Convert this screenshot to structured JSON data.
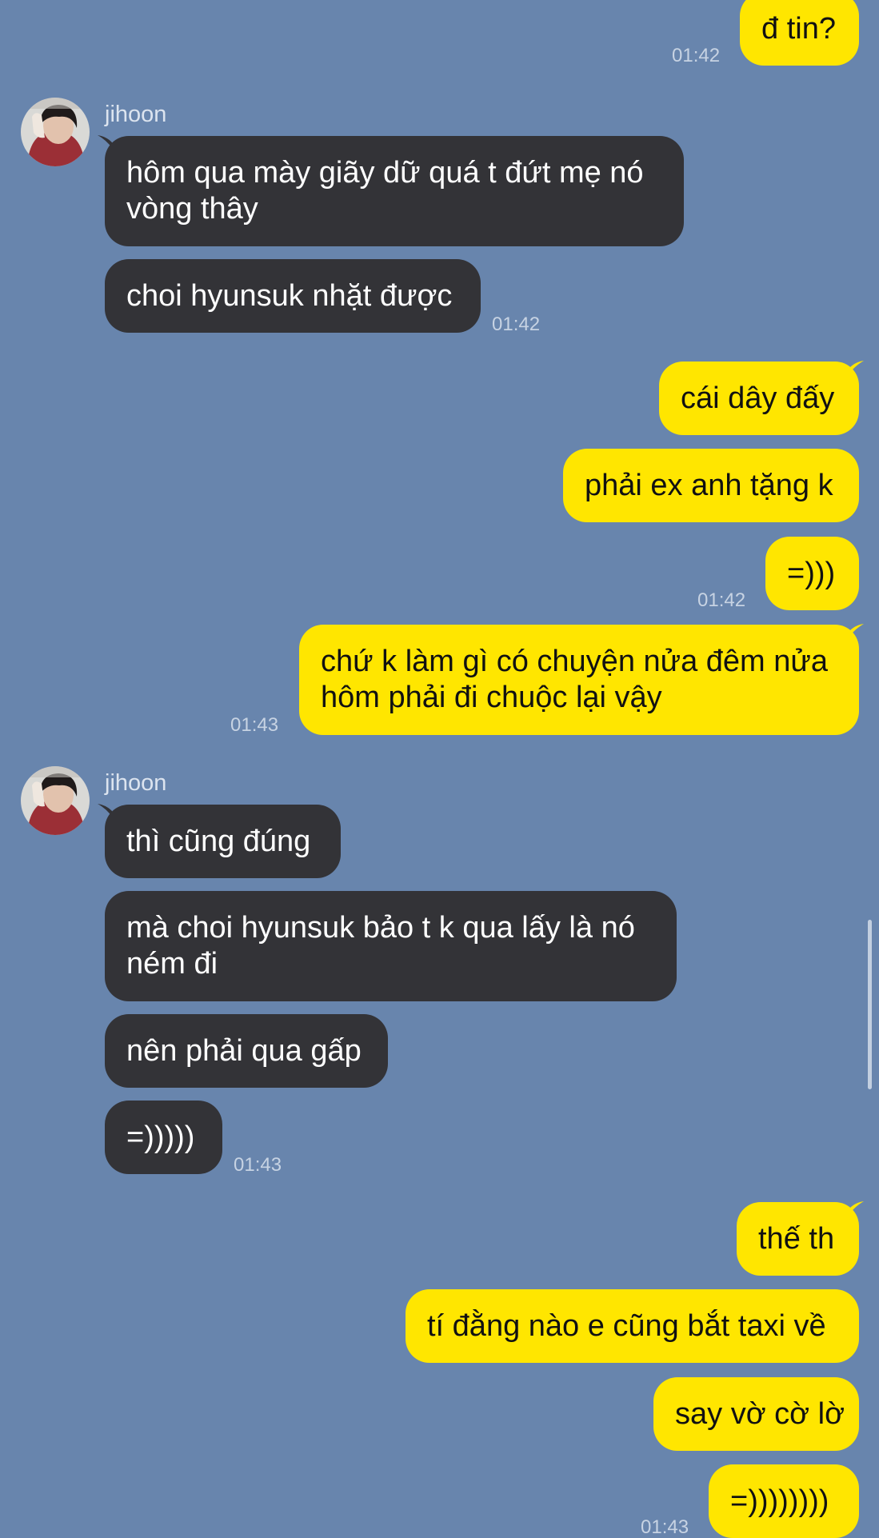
{
  "colors": {
    "background": "#6885ad",
    "incoming_bubble": "#333337",
    "outgoing_bubble": "#ffe600",
    "timestamp": "#c7d3e3"
  },
  "chat": {
    "contact_name": "jihoon",
    "messages": [
      {
        "side": "out",
        "text": "đ tin?",
        "time": "01:42"
      },
      {
        "side": "in",
        "sender": "jihoon",
        "text": "hôm qua mày giãy dữ quá t đứt mẹ nó\nvòng thây"
      },
      {
        "side": "in",
        "text": "choi hyunsuk nhặt được",
        "time": "01:42"
      },
      {
        "side": "out",
        "text": "cái dây đấy"
      },
      {
        "side": "out",
        "text": "phải ex anh tặng k"
      },
      {
        "side": "out",
        "text": "=)))",
        "time": "01:42"
      },
      {
        "side": "out",
        "text": "chứ k làm gì có chuyện nửa đêm nửa\nhôm phải đi chuộc lại vậy",
        "time": "01:43"
      },
      {
        "side": "in",
        "sender": "jihoon",
        "text": "thì cũng đúng"
      },
      {
        "side": "in",
        "text": "mà choi hyunsuk bảo t k qua lấy là nó\nném đi"
      },
      {
        "side": "in",
        "text": "nên phải qua gấp"
      },
      {
        "side": "in",
        "text": "=)))))",
        "time": "01:43"
      },
      {
        "side": "out",
        "text": "thế th"
      },
      {
        "side": "out",
        "text": "tí đằng nào e cũng bắt taxi về"
      },
      {
        "side": "out",
        "text": "say vờ cờ lờ"
      },
      {
        "side": "out",
        "text": "=))))))))",
        "time": "01:43"
      }
    ]
  }
}
